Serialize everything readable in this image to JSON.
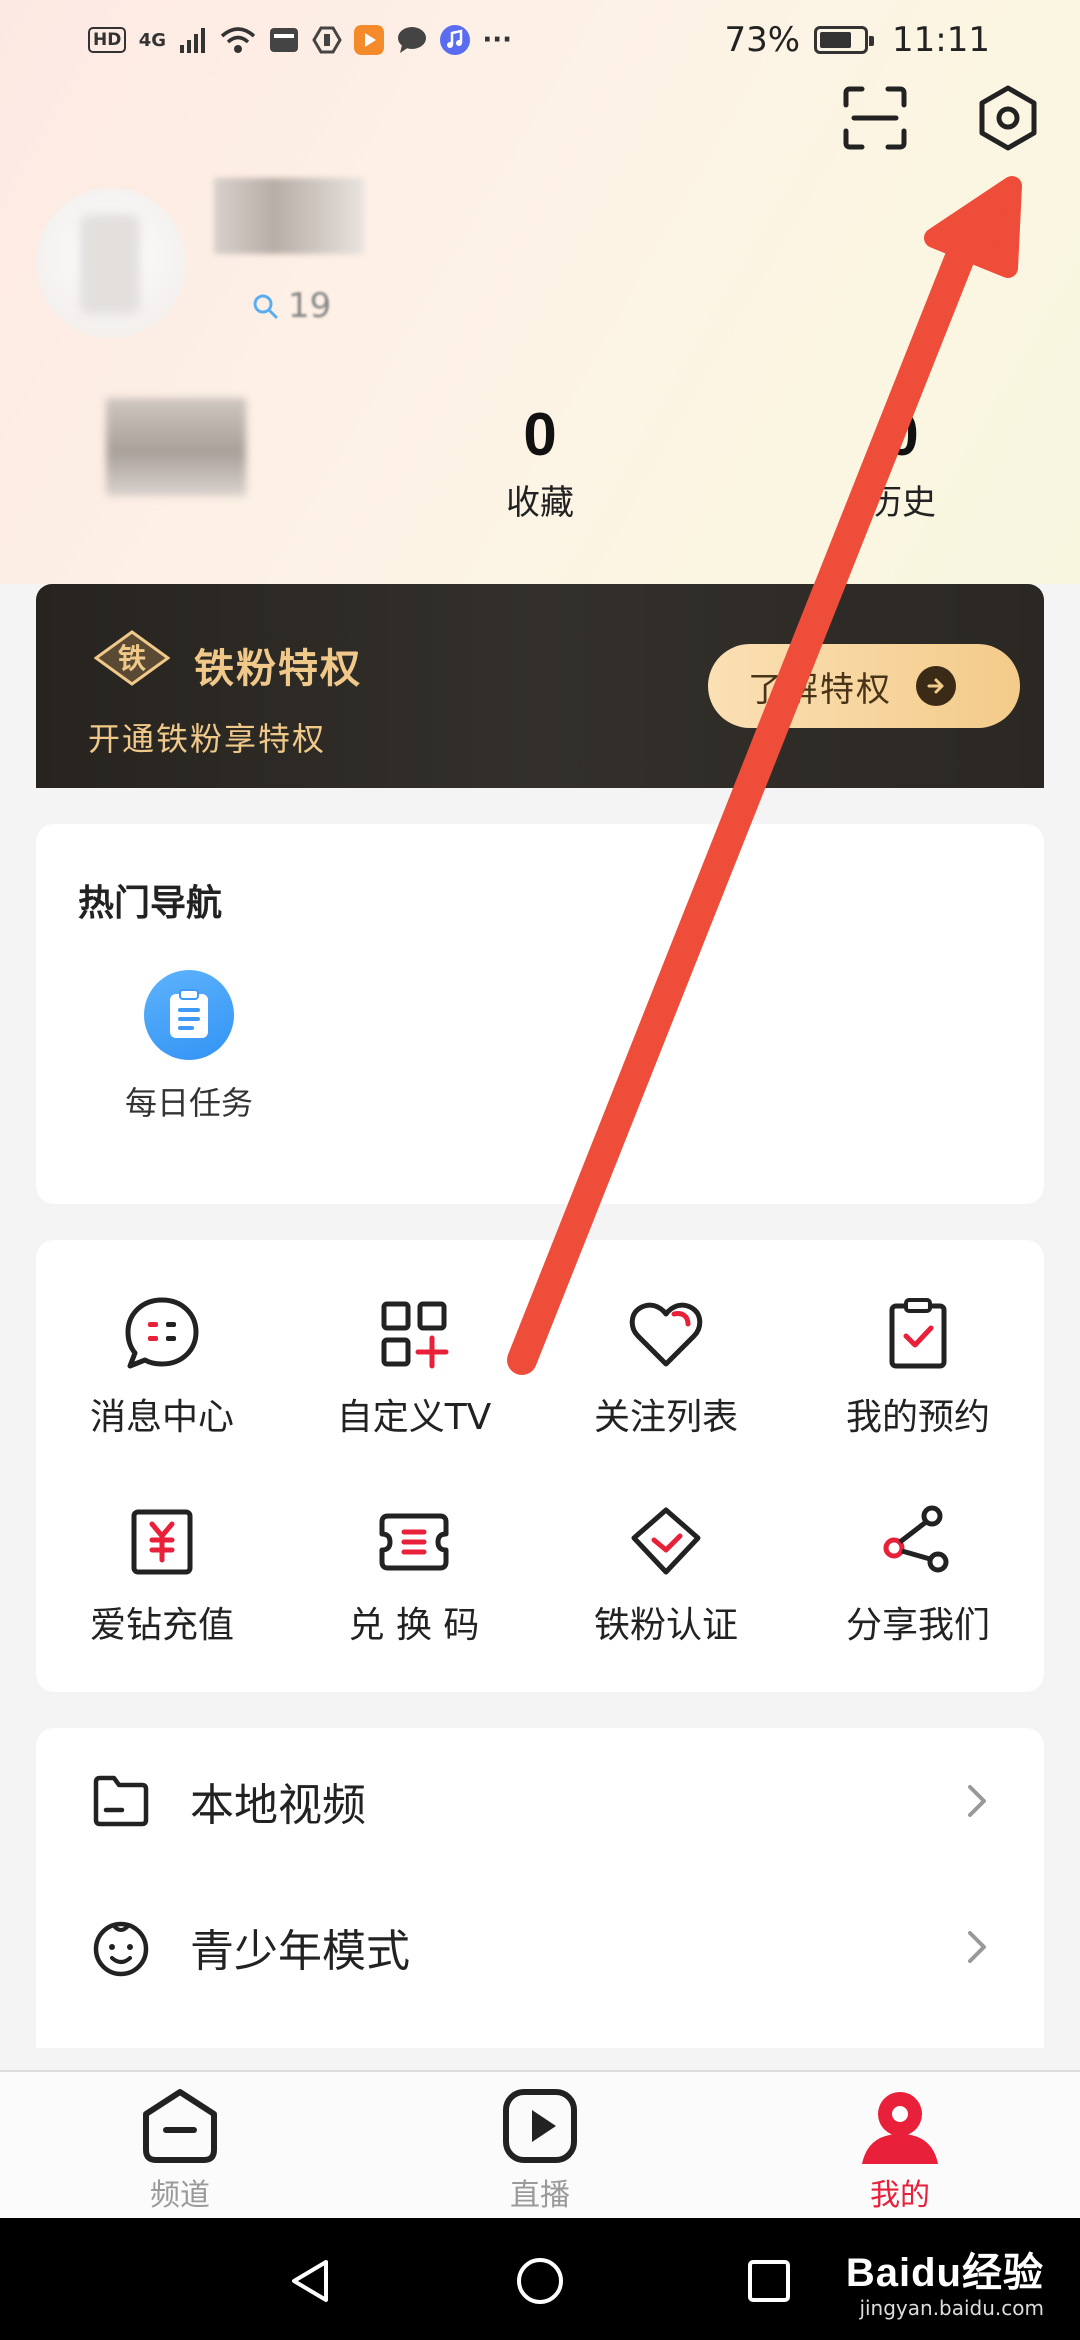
{
  "status_bar": {
    "left_icons": [
      "HD",
      "4G",
      "signal-icon",
      "wifi-icon",
      "huawei-icon",
      "hand-icon",
      "video-app-icon",
      "chat-icon",
      "music-icon"
    ],
    "more": "···",
    "battery_percent": "73%",
    "battery_level": 0.73,
    "time": "11:11"
  },
  "header": {
    "scan_icon": "scan-icon",
    "settings_icon": "settings-gear-icon"
  },
  "profile": {
    "uid_partial": "19"
  },
  "stats": {
    "favorites": {
      "value": "0",
      "label": "收藏"
    },
    "history": {
      "value": "0",
      "label": "历史"
    }
  },
  "vip": {
    "badge": "铁",
    "title": "铁粉特权",
    "subtitle": "开通铁粉享特权",
    "button_label": "了解特权"
  },
  "hot_nav": {
    "title": "热门导航",
    "items": [
      {
        "label": "每日任务",
        "icon": "clipboard-icon"
      }
    ]
  },
  "features": {
    "items": [
      {
        "label": "消息中心",
        "icon": "message-icon"
      },
      {
        "label": "自定义TV",
        "icon": "custom-tv-grid-icon"
      },
      {
        "label": "关注列表",
        "icon": "heart-icon"
      },
      {
        "label": "我的预约",
        "icon": "reservation-icon"
      },
      {
        "label": "爱钻充值",
        "icon": "recharge-icon"
      },
      {
        "label": "兑 换 码",
        "icon": "redeem-code-icon"
      },
      {
        "label": "铁粉认证",
        "icon": "fan-verify-icon"
      },
      {
        "label": "分享我们",
        "icon": "share-icon"
      }
    ]
  },
  "list": {
    "items": [
      {
        "label": "本地视频",
        "icon": "folder-icon"
      },
      {
        "label": "青少年模式",
        "icon": "child-face-icon"
      }
    ]
  },
  "tabs": [
    {
      "label": "频道",
      "icon": "channel-icon"
    },
    {
      "label": "直播",
      "icon": "live-play-icon"
    },
    {
      "label": "我的",
      "icon": "profile-icon"
    }
  ],
  "watermark": {
    "main": "Baidu经验",
    "sub": "jingyan.baidu.com"
  },
  "colors": {
    "accent_red": "#e8203a",
    "gold": "#f0c98a",
    "arrow_red": "#ee4d3a"
  }
}
